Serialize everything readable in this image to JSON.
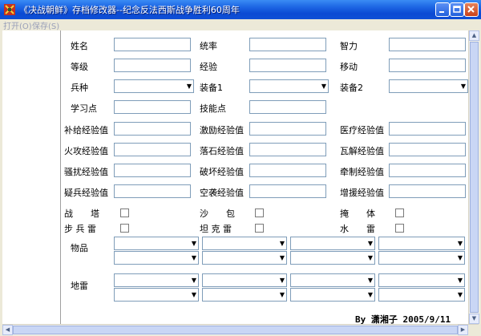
{
  "window": {
    "title": "《决战朝鲜》存档修改器--纪念反法西斯战争胜利60周年",
    "menu": [
      "打开(O)",
      "保存(S)"
    ]
  },
  "row1": {
    "name_label": "姓名",
    "command_label": "统率",
    "intellect_label": "智力"
  },
  "row2": {
    "level_label": "等级",
    "exp_label": "经验",
    "move_label": "移动"
  },
  "row3": {
    "branch_label": "兵种",
    "equip1_label": "装备1",
    "equip2_label": "装备2"
  },
  "row4": {
    "learn_label": "学习点",
    "skill_label": "技能点"
  },
  "exp_rows": [
    [
      "补给经验值",
      "激励经验值",
      "医疗经验值"
    ],
    [
      "火攻经验值",
      "落石经验值",
      "瓦解经验值"
    ],
    [
      "骚扰经验值",
      "破坏经验值",
      "牵制经验值"
    ],
    [
      "疑兵经验值",
      "空袭经验值",
      "增援经验值"
    ]
  ],
  "checks": {
    "row1": [
      "战　　塔",
      "沙　　包",
      "掩　　体"
    ],
    "row2": [
      "步 兵 雷",
      "坦 克 雷",
      "水　　雷"
    ]
  },
  "items_label": "物品",
  "mines_label": "地雷",
  "signature": "By 潇湘子 2005/9/11"
}
